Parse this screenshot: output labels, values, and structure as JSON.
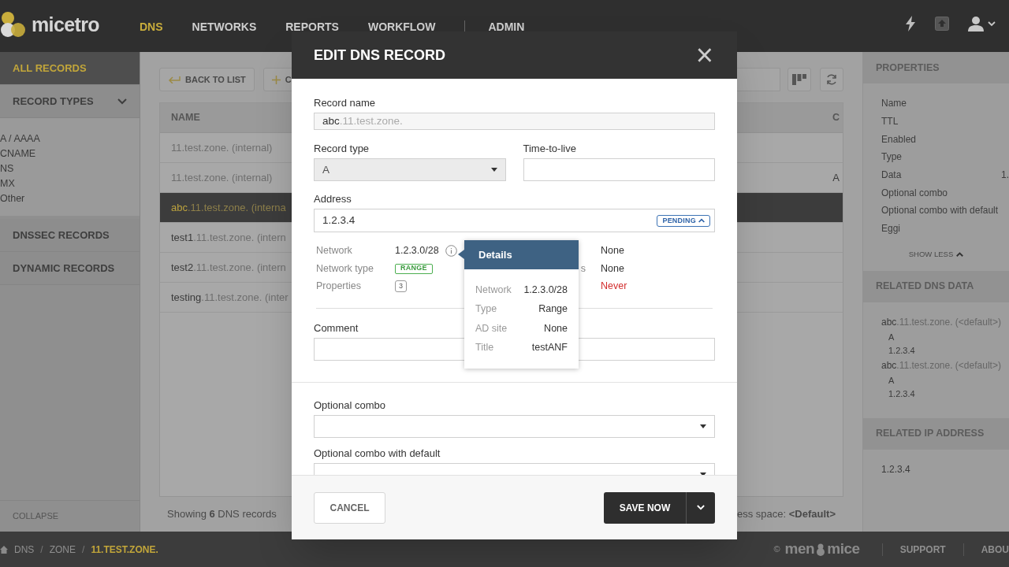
{
  "app": {
    "logo": "micetro"
  },
  "nav": [
    {
      "label": "DNS",
      "selected": true
    },
    {
      "label": "NETWORKS",
      "selected": false
    },
    {
      "label": "REPORTS",
      "selected": false
    },
    {
      "label": "WORKFLOW",
      "selected": false
    },
    {
      "label": "ADMIN",
      "selected": false
    }
  ],
  "sidebar": {
    "items": [
      {
        "label": "ALL RECORDS",
        "kind": "section",
        "selected": true
      },
      {
        "label": "RECORD TYPES",
        "kind": "group",
        "expanded": true,
        "children": [
          {
            "label": "A / AAAA"
          },
          {
            "label": "CNAME"
          },
          {
            "label": "NS"
          },
          {
            "label": "MX"
          },
          {
            "label": "Other"
          }
        ]
      },
      {
        "label": "DNSSEC RECORDS",
        "kind": "section",
        "selected": false
      },
      {
        "label": "DYNAMIC RECORDS",
        "kind": "section",
        "selected": false
      }
    ],
    "collapse": "COLLAPSE"
  },
  "toolbar": {
    "buttons": [
      {
        "label": "BACK TO LIST"
      },
      {
        "label": "C"
      }
    ]
  },
  "table": {
    "columns": [
      "NAME",
      "C"
    ],
    "rows": [
      {
        "zone": "11.test.zone. (internal)",
        "selected": false
      },
      {
        "zone": "11.test.zone. (internal)",
        "column_2": "A",
        "selected": false
      },
      {
        "host": "abc",
        "zone": ".11.test.zone. (interna",
        "selected": true
      },
      {
        "host": "test1",
        "zone": ".11.test.zone. (intern",
        "selected": false
      },
      {
        "host": "test2",
        "zone": ".11.test.zone. (intern",
        "selected": false
      },
      {
        "host": "testing",
        "zone": ".11.test.zone. (inter",
        "selected": false
      }
    ],
    "footer_left": "Showing **6** DNS records",
    "footer_right": "ess space: **<Default>**"
  },
  "properties": {
    "title": "PROPERTIES",
    "items": [
      {
        "label": "Name"
      },
      {
        "label": "TTL"
      },
      {
        "label": "Enabled"
      },
      {
        "label": "Type"
      },
      {
        "label": "Data",
        "value": "1."
      },
      {
        "label": "Optional combo"
      },
      {
        "label": "Optional combo with default"
      },
      {
        "label": "Eggi"
      }
    ],
    "toggle": "SHOW LESS"
  },
  "related_dns": {
    "title": "RELATED DNS DATA",
    "items": [
      {
        "host": "abc",
        "zone": ".11.test.zone. (<default>)",
        "type": "A",
        "data": "1.2.3.4"
      },
      {
        "host": "abc",
        "zone": ".11.test.zone. (<default>)",
        "type": "A",
        "data": "1.2.3.4"
      }
    ]
  },
  "related_ip": {
    "title": "RELATED IP ADDRESS",
    "items": [
      "1.2.3.4"
    ]
  },
  "dialog": {
    "title": "EDIT DNS RECORD",
    "close": "×",
    "record_name": {
      "label": "Record name",
      "host": "abc",
      "zone": ".11.test.zone."
    },
    "record_type": {
      "label": "Record type",
      "value": "A",
      "disabled": true
    },
    "ttl": {
      "label": "Time-to-live"
    },
    "address": {
      "label": "Address",
      "value": "1.2.3.4",
      "badge": "PENDING"
    },
    "details": [
      {
        "label": "Network",
        "value": "1.2.3.0/28",
        "kind": "text",
        "right_value": "None",
        "alert": false
      },
      {
        "label": "Network type",
        "value": "RANGE",
        "kind": "tag",
        "right_label": "s",
        "right_value": "None",
        "alert": false
      },
      {
        "label": "Properties",
        "value": "3",
        "kind": "count",
        "right_value": "Never",
        "alert": true
      }
    ],
    "tooltip": {
      "title": "Details",
      "rows": [
        {
          "label": "Network",
          "value": "1.2.3.0/28"
        },
        {
          "label": "Type",
          "value": "Range"
        },
        {
          "label": "AD site",
          "value": "None"
        },
        {
          "label": "Title",
          "value": "testANF"
        }
      ]
    },
    "comment": {
      "label": "Comment"
    },
    "combos": [
      {
        "label": "Optional combo"
      },
      {
        "label": "Optional combo with default"
      }
    ],
    "cancel": "CANCEL",
    "save": "SAVE NOW"
  },
  "breadcrumb": {
    "separator": "/",
    "items": [
      "DNS",
      "ZONE",
      "11.TEST.ZONE."
    ]
  },
  "footer": {
    "copyright": "©",
    "logo_parts": [
      "men",
      "mice"
    ],
    "links": [
      "SUPPORT",
      "ABOU"
    ]
  }
}
